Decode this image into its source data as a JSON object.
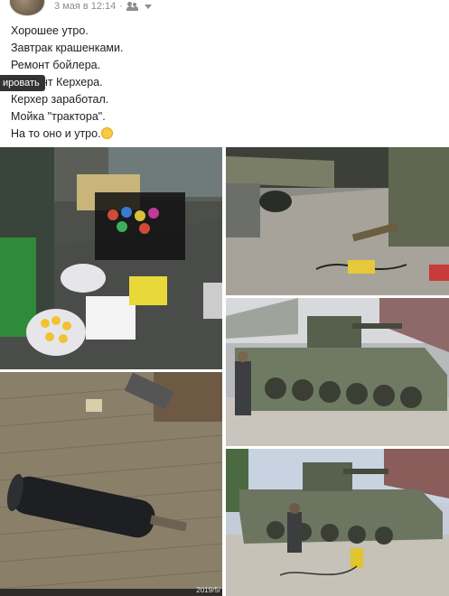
{
  "post": {
    "date": "3 мая в 12:14",
    "lines": [
      "Хорошее утро.",
      "Завтрак крашенками.",
      "Ремонт бойлера.",
      "нт Керхера.",
      "Керхер заработал.",
      "Мойка \"трактора\".",
      "На то оно и утро."
    ],
    "tooltip": "ировать"
  },
  "photos": {
    "stamp": "2019/5/"
  }
}
